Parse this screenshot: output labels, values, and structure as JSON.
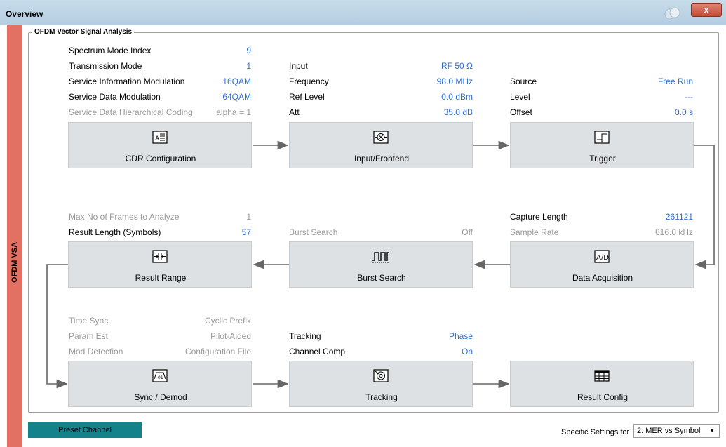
{
  "window": {
    "title": "Overview",
    "close_label": "x"
  },
  "sidebar": {
    "label": "OFDM VSA"
  },
  "group": {
    "title": "OFDM Vector Signal Analysis"
  },
  "cdr_params": [
    {
      "label": "Spectrum Mode Index",
      "value": "9",
      "dim": false
    },
    {
      "label": "Transmission Mode",
      "value": "1",
      "dim": false
    },
    {
      "label": "Service Information Modulation",
      "value": "16QAM",
      "dim": false
    },
    {
      "label": "Service Data Modulation",
      "value": "64QAM",
      "dim": false
    },
    {
      "label": "Service Data Hierarchical Coding",
      "value": "alpha = 1",
      "dim": true
    }
  ],
  "input_params": [
    {
      "label": "Input",
      "value": "RF 50 Ω"
    },
    {
      "label": "Frequency",
      "value": "98.0 MHz"
    },
    {
      "label": "Ref Level",
      "value": "0.0 dBm"
    },
    {
      "label": "Att",
      "value": "35.0 dB"
    }
  ],
  "trigger_params": [
    {
      "label": "Source",
      "value": "Free Run"
    },
    {
      "label": "Level",
      "value": "---"
    },
    {
      "label": "Offset",
      "value": "0.0 s"
    }
  ],
  "range_params": [
    {
      "label": "Max No of Frames to Analyze",
      "value": "1",
      "dim": true
    },
    {
      "label": "Result Length (Symbols)",
      "value": "57",
      "dim": false
    }
  ],
  "burst_params": [
    {
      "label": "Burst Search",
      "value": "Off"
    }
  ],
  "acq_params": [
    {
      "label": "Capture Length",
      "value": "261121",
      "dim": false
    },
    {
      "label": "Sample Rate",
      "value": "816.0 kHz",
      "dim": true
    }
  ],
  "sync_params": [
    {
      "label": "Time Sync",
      "value": "Cyclic Prefix"
    },
    {
      "label": "Param Est",
      "value": "Pilot-Aided"
    },
    {
      "label": "Mod Detection",
      "value": "Configuration File"
    }
  ],
  "tracking_params": [
    {
      "label": "Tracking",
      "value": "Phase"
    },
    {
      "label": "Channel Comp",
      "value": "On"
    }
  ],
  "blocks": {
    "cdr": "CDR Configuration",
    "input": "Input/Frontend",
    "trigger": "Trigger",
    "range": "Result Range",
    "burst": "Burst Search",
    "acq": "Data Acquisition",
    "sync": "Sync / Demod",
    "tracking": "Tracking",
    "result": "Result Config"
  },
  "footer": {
    "preset_label": "Preset Channel",
    "specific_label": "Specific Settings for",
    "specific_value": "2: MER vs Symbol"
  },
  "colors": {
    "accent_value": "#2f6fd6",
    "sidebar": "#e27063",
    "preset": "#13828a",
    "block": "#dde1e4"
  }
}
